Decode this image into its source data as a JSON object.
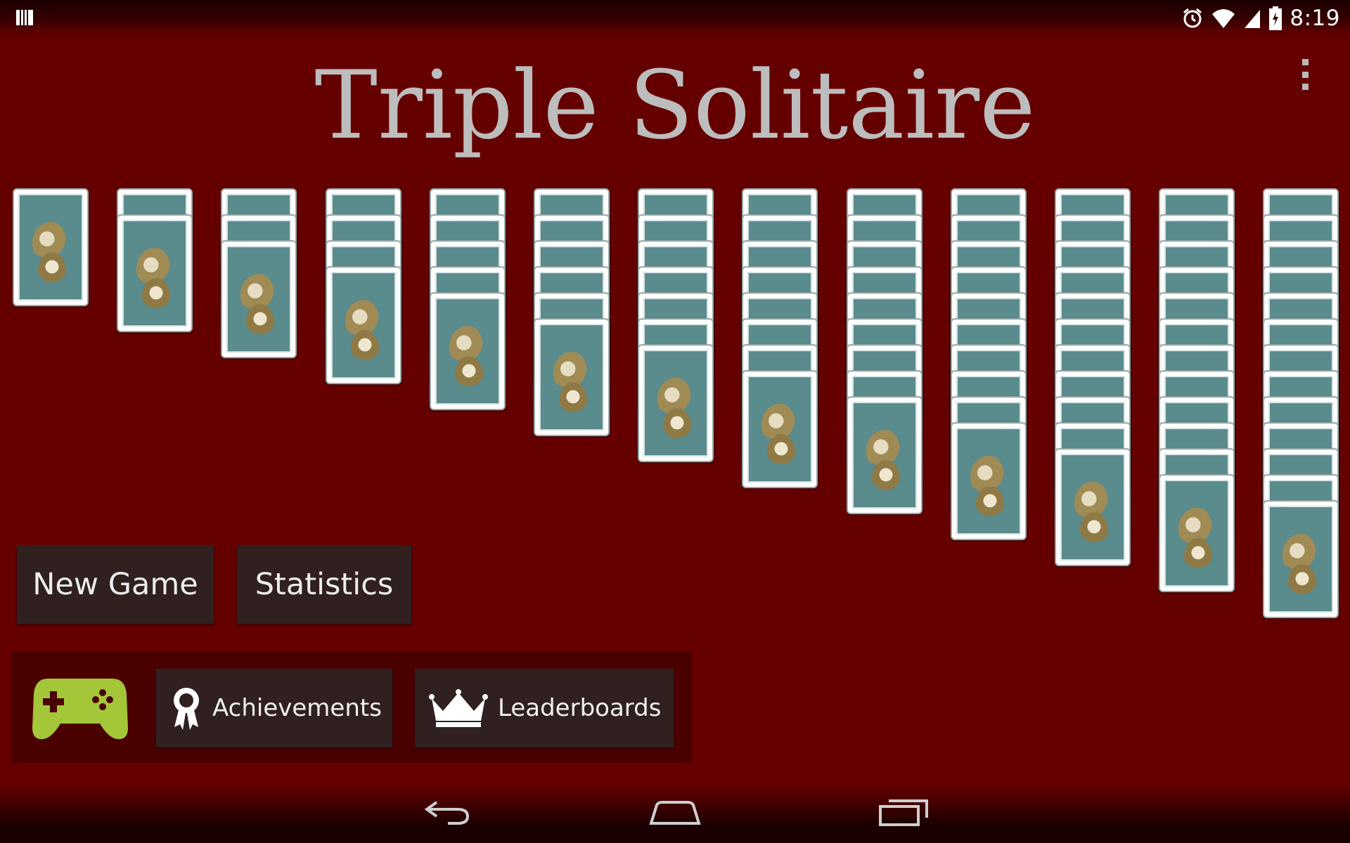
{
  "status_bar": {
    "time": "8:19",
    "icons": [
      "notification-icon",
      "alarm-icon",
      "wifi-icon",
      "signal-icon",
      "battery-charging-icon"
    ]
  },
  "app": {
    "title": "Triple Solitaire",
    "background_color": "#640000",
    "title_color": "#bdbdbd"
  },
  "tableau": {
    "columns": [
      {
        "face_down": 0,
        "face_up_back": 1
      },
      {
        "face_down": 1,
        "face_up_back": 1
      },
      {
        "face_down": 2,
        "face_up_back": 1
      },
      {
        "face_down": 3,
        "face_up_back": 1
      },
      {
        "face_down": 4,
        "face_up_back": 1
      },
      {
        "face_down": 5,
        "face_up_back": 1
      },
      {
        "face_down": 6,
        "face_up_back": 1
      },
      {
        "face_down": 7,
        "face_up_back": 1
      },
      {
        "face_down": 8,
        "face_up_back": 1
      },
      {
        "face_down": 9,
        "face_up_back": 1
      },
      {
        "face_down": 10,
        "face_up_back": 1
      },
      {
        "face_down": 11,
        "face_up_back": 1
      },
      {
        "face_down": 12,
        "face_up_back": 1
      }
    ],
    "card_back_color": "#5a8b8d"
  },
  "buttons": {
    "new_game": "New Game",
    "statistics": "Statistics"
  },
  "games_panel": {
    "achievements": "Achievements",
    "leaderboards": "Leaderboards",
    "controller_color": "#a4c639"
  },
  "nav_bar": {
    "icons": [
      "back-icon",
      "home-icon",
      "recents-icon"
    ]
  }
}
